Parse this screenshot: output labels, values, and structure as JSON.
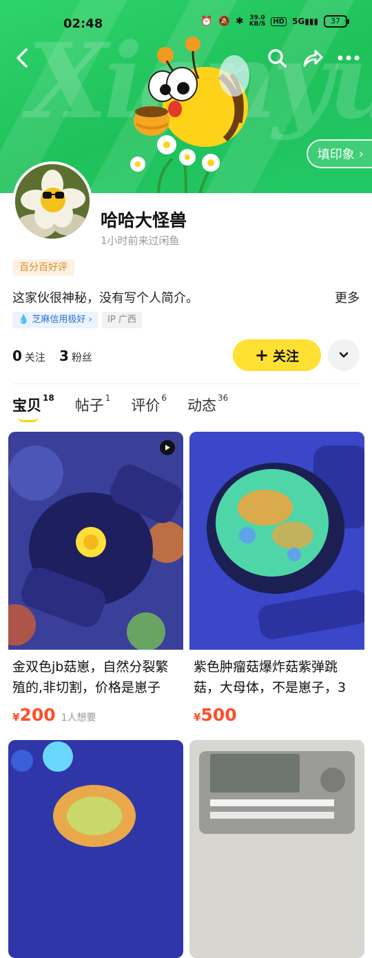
{
  "status_bar": {
    "time": "02:48",
    "net_speed": "39.0",
    "net_unit": "KB/S",
    "hd": "HD",
    "signal": "5G",
    "battery": "37"
  },
  "banner": {
    "watermark": "Xianyu",
    "stamp_button": "填印象"
  },
  "profile": {
    "name": "哈哈大怪兽",
    "last_seen": "1小时前来过闲鱼",
    "badge": "百分百好评",
    "bio": "这家伙很神秘，没有写个人简介。",
    "more": "更多",
    "credit_tag": "芝麻信用极好",
    "ip_label": "IP",
    "ip_value": "广西"
  },
  "stats": {
    "following_count": "0",
    "following_label": "关注",
    "fans_count": "3",
    "fans_label": "粉丝"
  },
  "follow_button": {
    "label": "关注"
  },
  "tabs": [
    {
      "label": "宝贝",
      "count": "18",
      "active": true
    },
    {
      "label": "帖子",
      "count": "1"
    },
    {
      "label": "评价",
      "count": "6"
    },
    {
      "label": "动态",
      "count": "36"
    }
  ],
  "items": [
    {
      "title": "金双色jb菇崽，自然分裂繁殖的,非切割，价格是崽子",
      "currency": "¥",
      "price": "200",
      "wants": "1人想要"
    },
    {
      "title": "紫色肿瘤菇爆炸菇紫弹跳菇，大母体，不是崽子，3",
      "currency": "¥",
      "price": "500",
      "wants": ""
    }
  ],
  "colors": {
    "brand_green": "#22c55e",
    "accent_yellow": "#ffe033",
    "price_red": "#ff4e2b"
  }
}
